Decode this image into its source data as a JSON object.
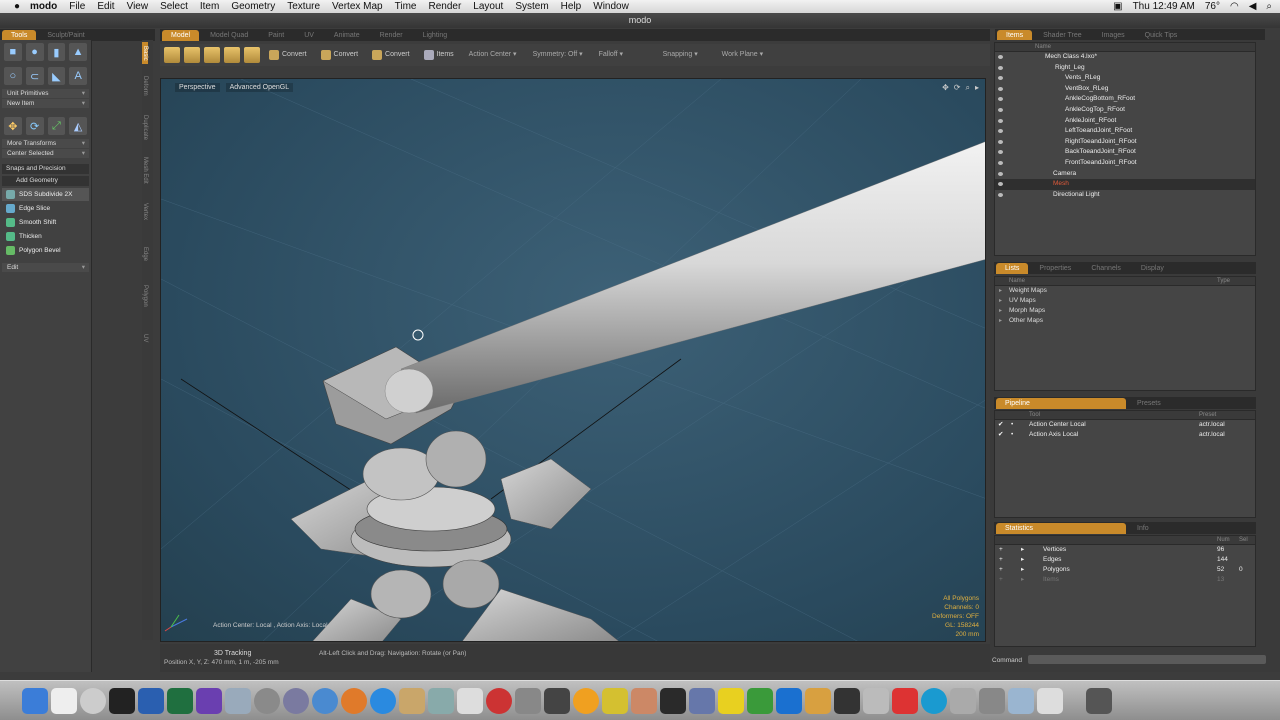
{
  "menubar": {
    "app_name": "modo",
    "items": [
      "File",
      "Edit",
      "View",
      "Select",
      "Item",
      "Geometry",
      "Texture",
      "Vertex Map",
      "Time",
      "Render",
      "Layout",
      "System",
      "Help",
      "Window"
    ],
    "clock": "Thu 12:49 AM",
    "temperature": "76°"
  },
  "window": {
    "title": "modo"
  },
  "left_tabs": [
    "Tools",
    "Sculpt/Paint"
  ],
  "main_tabs": [
    "Model",
    "Model Quad",
    "Paint",
    "UV",
    "Animate",
    "Render",
    "Lighting"
  ],
  "vertical_tabs": [
    "Basic",
    "Deform",
    "Duplicate",
    "Mesh Edit",
    "Vertex",
    "Edge",
    "Polygon",
    "UV"
  ],
  "left_panel": {
    "unit_primitives": "Unit Primitives",
    "new_item": "New Item",
    "more_transforms": "More Transforms",
    "center_selected": "Center Selected",
    "snaps_precision": "Snaps and Precision",
    "add_geometry": "Add Geometry",
    "tools": [
      "SDS Subdivide 2X",
      "Edge Slice",
      "Smooth Shift",
      "Thicken",
      "Polygon Bevel"
    ],
    "edit": "Edit"
  },
  "toolbar": {
    "convert_labels": [
      "Convert",
      "Convert",
      "Convert"
    ],
    "items": "Items",
    "action_center": "Action Center",
    "symmetry": "Symmetry: Off",
    "falloff": "Falloff",
    "snapping": "Snapping",
    "work_plane": "Work Plane"
  },
  "viewport": {
    "view_mode": "Perspective",
    "render_mode": "Advanced OpenGL",
    "action_label": "Action Center: Local , Action Axis: Local",
    "stats": [
      "All Polygons",
      "Channels: 0",
      "Deformers: OFF",
      "GL: 158244",
      "200 mm"
    ]
  },
  "status": {
    "title": "3D Tracking",
    "position": "Position X, Y, Z:  470 mm, 1 m, -205 mm",
    "hint": "Alt-Left Click and Drag:  Navigation: Rotate (or Pan)"
  },
  "right_tabs_top": [
    "Items",
    "Shader Tree",
    "Images",
    "Quick Tips"
  ],
  "items_panel": {
    "header": "Name",
    "rows": [
      {
        "label": "Mech Class 4.lxo*",
        "indent": 50
      },
      {
        "label": "Right_Leg",
        "indent": 60
      },
      {
        "label": "Vents_RLeg",
        "indent": 70
      },
      {
        "label": "VentBox_RLeg",
        "indent": 70
      },
      {
        "label": "AnkleCogBottom_RFoot",
        "indent": 70
      },
      {
        "label": "AnkleCogTop_RFoot",
        "indent": 70
      },
      {
        "label": "AnkleJoint_RFoot",
        "indent": 70
      },
      {
        "label": "LeftToeandJoint_RFoot",
        "indent": 70
      },
      {
        "label": "RightToeandJoint_RFoot",
        "indent": 70
      },
      {
        "label": "BackToeandJoint_RFoot",
        "indent": 70
      },
      {
        "label": "FrontToeandJoint_RFoot",
        "indent": 70
      },
      {
        "label": "Camera",
        "indent": 58
      },
      {
        "label": "Mesh",
        "indent": 58,
        "selected": true
      },
      {
        "label": "Directional Light",
        "indent": 58
      }
    ]
  },
  "lists_tabs": [
    "Lists",
    "Properties",
    "Channels",
    "Display"
  ],
  "lists_panel": {
    "name_header": "Name",
    "type_header": "Type",
    "rows": [
      "Weight Maps",
      "UV Maps",
      "Morph Maps",
      "Other Maps"
    ]
  },
  "pipeline_tabs": [
    "Pipeline",
    "Presets"
  ],
  "pipeline_panel": {
    "tool_header": "Tool",
    "preset_header": "Preset",
    "rows": [
      {
        "tool": "Action Center Local",
        "preset": "actr.local"
      },
      {
        "tool": "Action Axis Local",
        "preset": "actr.local"
      }
    ]
  },
  "statistics_tabs": [
    "Statistics",
    "Info"
  ],
  "statistics_panel": {
    "num_header": "Num",
    "sel_header": "Sel",
    "rows": [
      {
        "name": "Vertices",
        "num": "96",
        "sel": ""
      },
      {
        "name": "Edges",
        "num": "144",
        "sel": ""
      },
      {
        "name": "Polygons",
        "num": "52",
        "sel": "0"
      },
      {
        "name": "Items",
        "num": "13",
        "sel": ""
      }
    ]
  },
  "command": {
    "label": "Command"
  },
  "colors": {
    "accent": "#c98a2a",
    "viewport_bg": "#2f5166"
  }
}
